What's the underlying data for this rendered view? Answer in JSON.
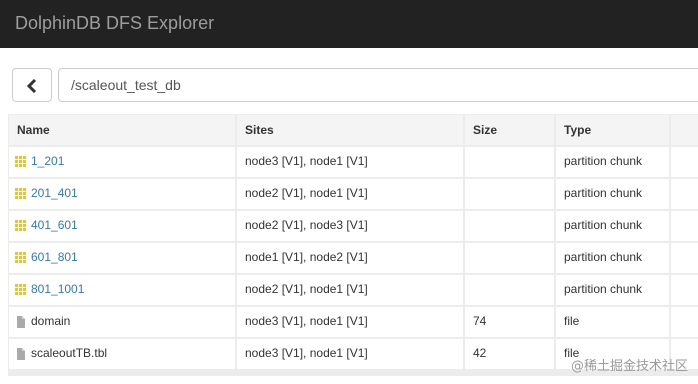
{
  "app": {
    "title": "DolphinDB DFS Explorer"
  },
  "nav": {
    "path": "/scaleout_test_db"
  },
  "table": {
    "headers": [
      "Name",
      "Sites",
      "Size",
      "Type"
    ],
    "rows": [
      {
        "name": "1_201",
        "sites": "node3 [V1], node1 [V1]",
        "size": "",
        "type": "partition chunk",
        "icon": "folder-grid-icon",
        "link": true
      },
      {
        "name": "201_401",
        "sites": "node2 [V1], node1 [V1]",
        "size": "",
        "type": "partition chunk",
        "icon": "folder-grid-icon",
        "link": true
      },
      {
        "name": "401_601",
        "sites": "node2 [V1], node3 [V1]",
        "size": "",
        "type": "partition chunk",
        "icon": "folder-grid-icon",
        "link": true
      },
      {
        "name": "601_801",
        "sites": "node1 [V1], node2 [V1]",
        "size": "",
        "type": "partition chunk",
        "icon": "folder-grid-icon",
        "link": true
      },
      {
        "name": "801_1001",
        "sites": "node2 [V1], node1 [V1]",
        "size": "",
        "type": "partition chunk",
        "icon": "folder-grid-icon",
        "link": true
      },
      {
        "name": "domain",
        "sites": "node3 [V1], node1 [V1]",
        "size": "74",
        "type": "file",
        "icon": "file-icon",
        "link": false
      },
      {
        "name": "scaleoutTB.tbl",
        "sites": "node3 [V1], node1 [V1]",
        "size": "42",
        "type": "file",
        "icon": "file-icon",
        "link": false
      }
    ]
  },
  "watermark": "@稀土掘金技术社区",
  "colors": {
    "navbar_bg": "#222222",
    "brand_text": "#9d9d9d",
    "link": "#337ab7",
    "folder_icon": "#f0c419",
    "file_icon": "#aaaaaa"
  }
}
